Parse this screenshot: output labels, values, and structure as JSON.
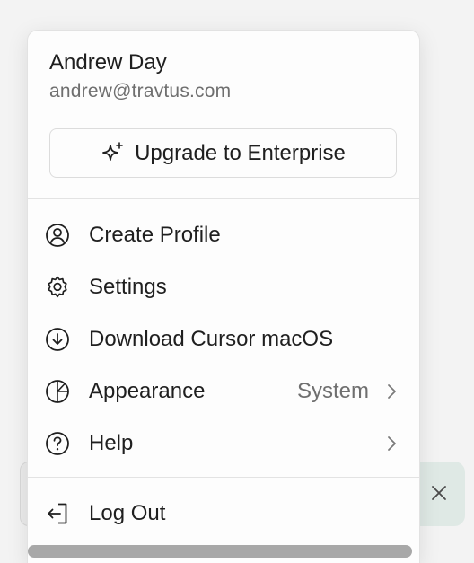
{
  "user": {
    "name": "Andrew Day",
    "email": "andrew@travtus.com"
  },
  "upgrade": {
    "label": "Upgrade to Enterprise",
    "icon": "sparkle-icon"
  },
  "menu_items": [
    {
      "label": "Create Profile",
      "icon": "user-circle-icon"
    },
    {
      "label": "Settings",
      "icon": "gear-icon"
    },
    {
      "label": "Download Cursor macOS",
      "icon": "download-circle-icon"
    },
    {
      "label": "Appearance",
      "value": "System",
      "icon": "theme-pie-icon",
      "has_submenu": true
    },
    {
      "label": "Help",
      "icon": "help-circle-icon",
      "has_submenu": true
    }
  ],
  "logout": {
    "label": "Log Out",
    "icon": "logout-icon"
  },
  "colors": {
    "menu_bg": "#fdfdfd",
    "text": "#1f1f1f",
    "muted": "#6f6f6f",
    "toast_bg": "#dfe9e5",
    "scrollbar": "#a8a8a8"
  }
}
